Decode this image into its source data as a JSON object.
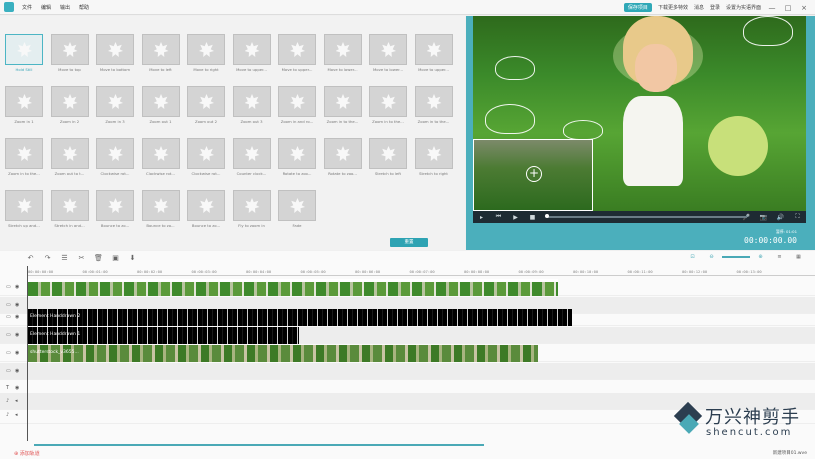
{
  "menubar": {
    "items": [
      "文件",
      "编辑",
      "输出",
      "帮助"
    ],
    "save_button": "保存项目",
    "links": [
      "下载更多特效",
      "消息",
      "登录",
      "设置为实语界面"
    ],
    "window_controls": [
      "—",
      "□",
      "×"
    ]
  },
  "library": {
    "rows": [
      [
        "Hold Still",
        "Move to top",
        "Move to bottom",
        "Move to left",
        "Move to right",
        "Move to upper...",
        "Move to upper...",
        "Move to lower...",
        "Move to lower...",
        "Move to upper..."
      ],
      [
        "Zoom in 1",
        "Zoom in 2",
        "Zoom in 3",
        "Zoom out 1",
        "Zoom out 2",
        "Zoom out 3",
        "Zoom in and ro...",
        "Zoom in to the...",
        "Zoom in to the...",
        "Zoom in to the..."
      ],
      [
        "Zoom in to the...",
        "Zoom out to t...",
        "Clockwise rot...",
        "Clockwise rot...",
        "Clockwise rot...",
        "Counter clock...",
        "Rotate to zoo...",
        "Rotate to zoo...",
        "Stretch to left",
        "Stretch to right"
      ],
      [
        "Stretch up and...",
        "Stretch in and...",
        "Bounce to zo...",
        "Bounce to zo...",
        "Bounce to zo...",
        "Fly to zoom in",
        "Fade"
      ]
    ],
    "selected": "Hold Still",
    "reset_button": "重置",
    "ok_button": "确定"
  },
  "preview": {
    "timecode_label": "暂停: 01:01",
    "timecode": "00:00:00.00",
    "controls": [
      "play-icon",
      "prev-icon",
      "play-icon",
      "stop-icon",
      "mic-icon",
      "camera-icon",
      "volume-icon",
      "fullscreen-icon"
    ]
  },
  "timeline": {
    "ruler": [
      "00:00:00:00",
      "00:00:01:00",
      "00:00:02:00",
      "00:00:03:00",
      "00:00:04:00",
      "00:00:05:00",
      "00:00:06:00",
      "00:00:07:00",
      "00:00:08:00",
      "00:00:09:00",
      "00:00:10:00",
      "00:00:11:00",
      "00:00:12:00",
      "00:00:13:00"
    ],
    "clips": {
      "clip1": "",
      "clip2": "Element Handdrawn 2",
      "clip3": "Element Handdrawn 1",
      "clip4": "shutterstock_v3655..."
    },
    "add_track": "添加轨道",
    "project_name": "新建项目01.wve"
  },
  "watermark": {
    "cn": "万兴神剪手",
    "en": "shencut.com"
  },
  "colors": {
    "accent": "#2fa8b7",
    "preview_bg": "#4bafbc"
  }
}
